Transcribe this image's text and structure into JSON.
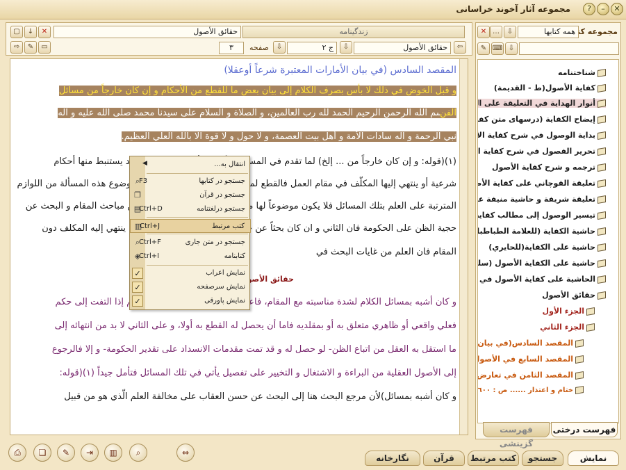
{
  "window": {
    "title": "مجموعه آثار آخوند خراسانی"
  },
  "left_panel": {
    "book_field": "حقائق الأصول",
    "tab_label": "زندگینامه",
    "nav_book": "حقائق الأصول",
    "volume": "ج ٢",
    "page_label": "صفحه",
    "page_value": "٣"
  },
  "right_panel": {
    "label": "مجموعه کتب",
    "dropdown_value": "همه کتابها",
    "search_value": "",
    "tree": [
      "شناختنامه",
      "كفاية الأصول(ط - القديمة)",
      "أنوار الهداية في التعليقة على الكفاية",
      "إيضاح الكفاية (درسهای متن كفاية ا",
      "بداية الوصول في شرح كفاية الأصول",
      "تحرير الفصول في شرح كفاية الأصو",
      "ترجمه و شرح كفاية الأصول",
      "تعليقة القوچاني على كفاية الأصول",
      "تعليقة شريفة و حاشية منيفة على كفا",
      "تيسير الوصول إلى مطالب كفاية الأ",
      "حاشية الكفاية (للعلامة الطباطبائي)",
      "حاشية على الكفاية(للحايري)",
      "حاشية على الكفاية الأصول (سلطان",
      "الحاشية على كفاية الأصول في الأصو",
      "حقائق الأصول",
      "الجزء الأول",
      "الجزء الثاني",
      "المقصد السادس(في بيان الأ",
      "المقصد السابع في الأصول ال",
      "المقصد الثامن في تعارض الأ",
      "ختام و اعتذار ...... ص : ٦٠٠"
    ],
    "tabs": [
      "فهرست درختی",
      "فهرست گزینشی"
    ]
  },
  "main_text": {
    "heading": "المقصد السادس (في بيان الأمارات المعتبرة شرعاً أوعقلا)",
    "hl_line1": "و قبل الخوض في ذلك لا بأس بصرف الكلام إلى بيان بعض ما للقطع من الأحكام و إن كان خارجاً من مسائل",
    "hl_line2_y": "الفن",
    "hl_line2": "بسم اللّه الرحمن الرحيم الحمد للّه رب العالمين، و الصلاة و السلام على سيدنا محمد صلى اللّه عليه و آله",
    "hl_line3": "نبي الرحمة و آله سادات الأمة و أهل بيت العصمة، و لا حول و لا قوة الا باللّه العلي العظيم.",
    "l4": "(١)(قوله: و إن كان خارجاً من ... إلخ) لما تقدم في المسائل الأصولية أنها عبارة عن قواعد يستنبط منها أحكام",
    "l5": "شرعية أو ينتهي إليها المكلّف في مقام العمل فالقطع لما لم يكن كذلك كان البحث عن موضوع هذه المسألة من اللوازم",
    "l6": "المترتبة على العلم بتلك المسائل فلا يكون موضوعاً لها مع أنه أشبه شيء بها لأنه أيضاً من مباحث المقام و البحث عن",
    "l7": "حجية الظن على الحكومة فان الثاني و ان كان بحثاً عن حكم العقل في مقام العمل إلا أنه ينتهي إليه المكلف دون",
    "l8": "المقام فان العلم من غايات البحث في",
    "l9": "حقائق الأصول، ج ٢، ص: ٣",
    "l10": "و كان أشبه بمسائل الكلام لشدة مناسبته مع المقام، فاعلم أن البالغ الذي وضع عليه القلم إذا التفت إلى حكم",
    "l11": "فعلي واقعي أو ظاهري متعلق به أو بمقلديه فاما أن يحصل له القطع به أولا، و على الثاني لا بد من انتهائه إلى",
    "l12": "ما استقل به العقل من اتباع الظن- لو حصل له و قد تمت مقدمات الانسداد على تقدير الحكومة- و إلا فالرجوع",
    "l13": "إلى الأصول العقلية من البراءة و الاشتغال و التخيير على تفصيل يأتي في تلك المسائل فتأمل جيداً (١)(قوله:",
    "l14": "و كان أشبه بمسائل)لأن مرجع البحث هنا إلى البحث عن حسن العقاب على مخالفة العلم الّذي هو من قبيل"
  },
  "context_menu": {
    "items": [
      {
        "label": "انتقال به...",
        "shortcut": "",
        "icon": "arrow-icon"
      },
      {
        "label": "جستجو در کتابها",
        "shortcut": "F3",
        "icon": "search-icon"
      },
      {
        "label": "جستجو در قرآن",
        "shortcut": "",
        "icon": "quran-icon"
      },
      {
        "label": "جستجو درلغتنامه",
        "shortcut": "Ctrl+D",
        "icon": "dictionary-icon"
      },
      {
        "label": "کتب مرتبط",
        "shortcut": "Ctrl+J",
        "icon": "books-icon"
      },
      {
        "label": "جستجو در متن جاری",
        "shortcut": "Ctrl+F",
        "icon": "find-icon"
      },
      {
        "label": "کتابنامه",
        "shortcut": "Ctrl+I",
        "icon": "bibliography-icon"
      },
      {
        "label": "نمایش اعراب",
        "shortcut": "",
        "icon": "check-icon"
      },
      {
        "label": "نمایش سرصفحه",
        "shortcut": "",
        "icon": "check-icon"
      },
      {
        "label": "نمایش پاورقی",
        "shortcut": "",
        "icon": "check-icon"
      }
    ]
  },
  "bottom_tabs": [
    "نمایش",
    "جستجو",
    "کتب مرتبط",
    "قرآن",
    "نگارخانه"
  ]
}
